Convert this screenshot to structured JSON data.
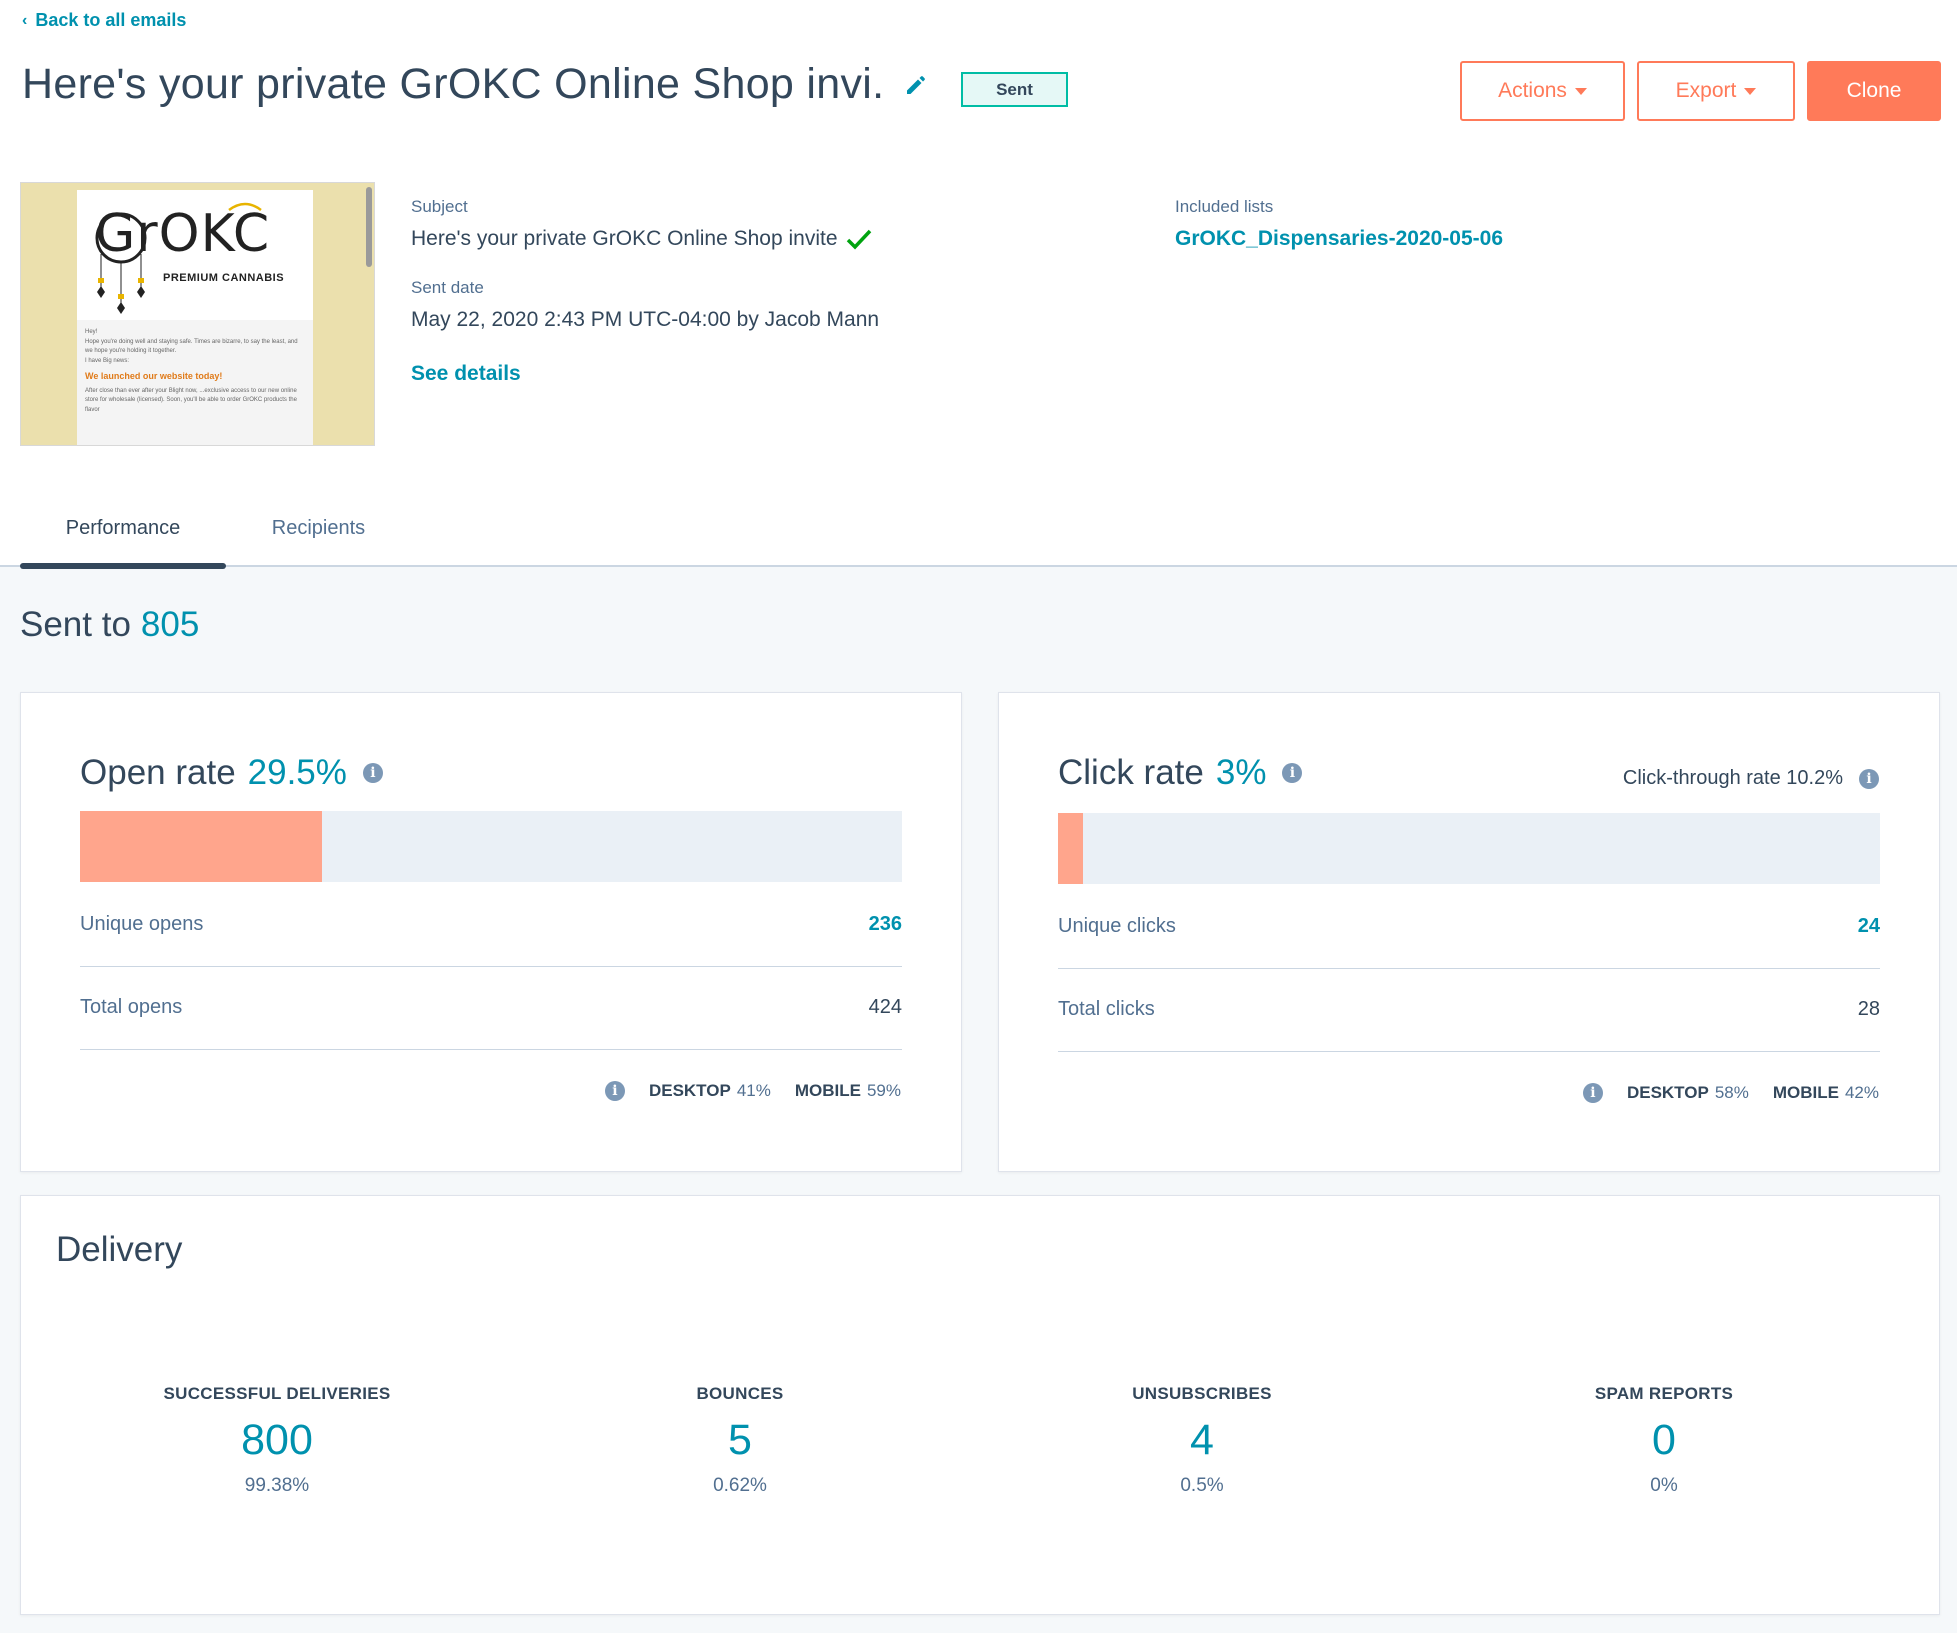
{
  "nav": {
    "back_label": "Back to all emails"
  },
  "header": {
    "title": "Here's your private GrOKC Online Shop invi.",
    "status": "Sent",
    "actions_label": "Actions",
    "export_label": "Export",
    "clone_label": "Clone"
  },
  "preview": {
    "brand": "GrOKC",
    "tagline": "PREMIUM CANNABIS",
    "greeting": "Hey!",
    "line1": "Hope you're doing well and staying safe. Times are bizarre, to say the least, and we hope you're holding it together.",
    "line2": "I have Big news:",
    "headline": "We launched our website today!",
    "line3": "After close than ever after your Blight now, ...exclusive access to our new online store for wholesale (licensed). Soon, you'll be able to order GrOKC products the flavor"
  },
  "details": {
    "subject_label": "Subject",
    "subject_value": "Here's your private GrOKC Online Shop invite",
    "sent_date_label": "Sent date",
    "sent_date_value": "May 22, 2020 2:43 PM UTC-04:00 by Jacob Mann",
    "see_details": "See details",
    "lists_label": "Included lists",
    "list_name": "GrOKC_Dispensaries-2020-05-06"
  },
  "tabs": [
    {
      "label": "Performance",
      "active": true
    },
    {
      "label": "Recipients",
      "active": false
    }
  ],
  "sent_to": {
    "label": "Sent to",
    "value": "805"
  },
  "open_card": {
    "title": "Open rate",
    "rate": "29.5%",
    "fill_percent": 29.5,
    "unique_label": "Unique opens",
    "unique_value": "236",
    "total_label": "Total opens",
    "total_value": "424",
    "desktop_label": "DESKTOP",
    "desktop_value": "41%",
    "mobile_label": "MOBILE",
    "mobile_value": "59%"
  },
  "click_card": {
    "title": "Click rate",
    "rate": "3%",
    "fill_percent": 3,
    "ctr_label": "Click-through rate 10.2%",
    "unique_label": "Unique clicks",
    "unique_value": "24",
    "total_label": "Total clicks",
    "total_value": "28",
    "desktop_label": "DESKTOP",
    "desktop_value": "58%",
    "mobile_label": "MOBILE",
    "mobile_value": "42%"
  },
  "delivery": {
    "title": "Delivery",
    "stats": [
      {
        "label": "SUCCESSFUL DELIVERIES",
        "value": "800",
        "percent": "99.38%"
      },
      {
        "label": "BOUNCES",
        "value": "5",
        "percent": "0.62%"
      },
      {
        "label": "UNSUBSCRIBES",
        "value": "4",
        "percent": "0.5%"
      },
      {
        "label": "SPAM REPORTS",
        "value": "0",
        "percent": "0%"
      }
    ]
  },
  "colors": {
    "accent": "#0091ae",
    "brand_orange": "#ff7a59",
    "bar_fill": "#ffa58c",
    "bar_track": "#eaf0f6",
    "badge_border": "#00bda5"
  },
  "icons": [
    "chevron-left-icon",
    "pencil-icon",
    "caret-down-icon",
    "check-icon",
    "info-icon"
  ]
}
